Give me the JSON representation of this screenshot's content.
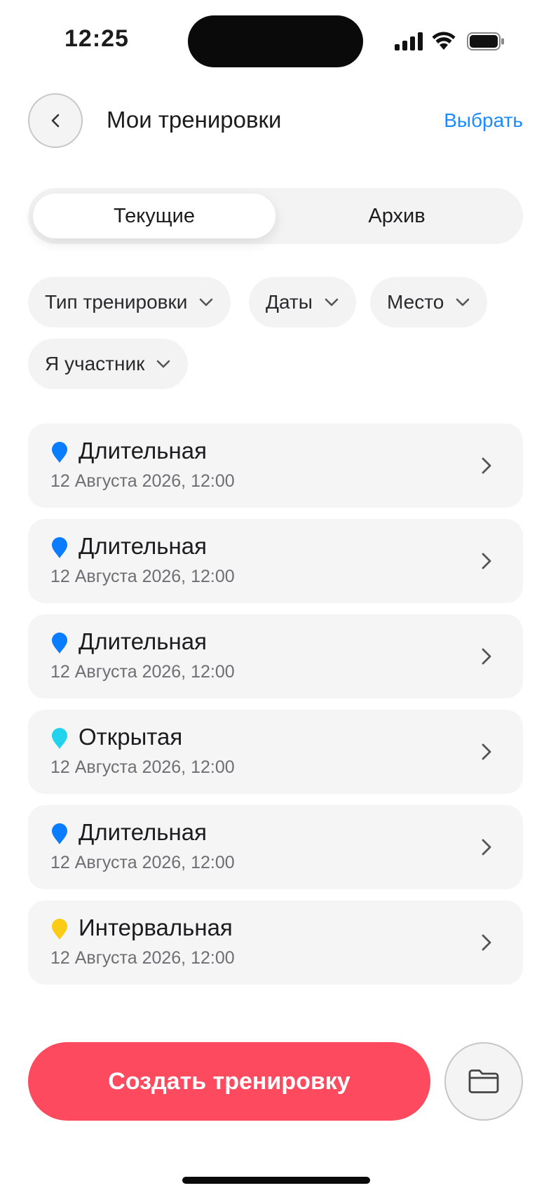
{
  "status_bar": {
    "time": "12:25"
  },
  "header": {
    "title": "Мои тренировки",
    "select_label": "Выбрать"
  },
  "tabs": [
    {
      "label": "Текущие",
      "active": true
    },
    {
      "label": "Архив",
      "active": false
    }
  ],
  "filters": [
    {
      "label": "Тип тренировки"
    },
    {
      "label": "Даты"
    },
    {
      "label": "Место"
    },
    {
      "label": "Я участник"
    }
  ],
  "trainings": [
    {
      "title": "Длительная",
      "datetime": "12 Августа 2026, 12:00",
      "pin_color": "#0a7cff"
    },
    {
      "title": "Длительная",
      "datetime": "12 Августа 2026, 12:00",
      "pin_color": "#0a7cff"
    },
    {
      "title": "Длительная",
      "datetime": "12 Августа 2026, 12:00",
      "pin_color": "#0a7cff"
    },
    {
      "title": "Открытая",
      "datetime": "12 Августа 2026, 12:00",
      "pin_color": "#22d3ee"
    },
    {
      "title": "Длительная",
      "datetime": "12 Августа 2026, 12:00",
      "pin_color": "#0a7cff"
    },
    {
      "title": "Интервальная",
      "datetime": "12 Августа 2026, 12:00",
      "pin_color": "#facc15"
    }
  ],
  "actions": {
    "create_label": "Создать тренировку"
  },
  "colors": {
    "accent": "#fd4a5f",
    "link": "#1a8cff"
  }
}
